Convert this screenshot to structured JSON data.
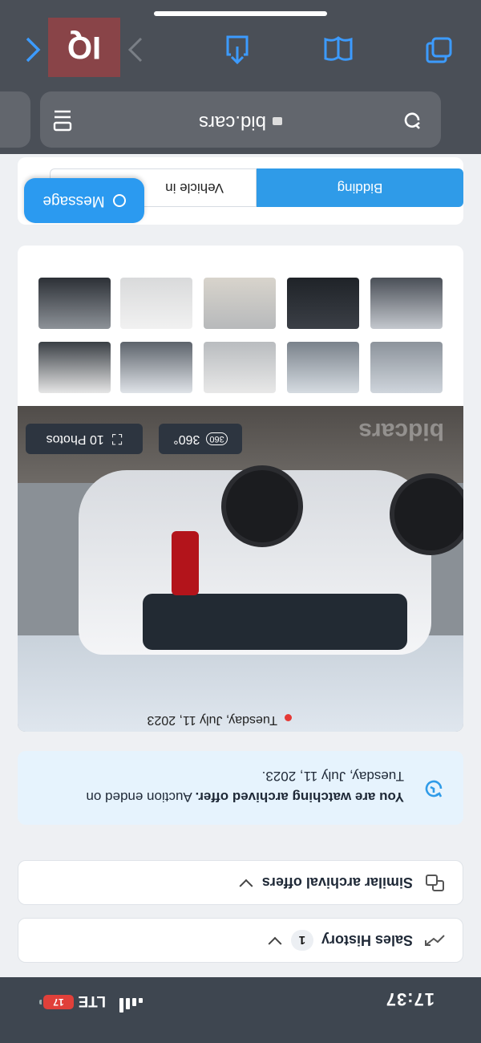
{
  "status_bar": {
    "time": "17:37",
    "network": "LTE",
    "battery": "17"
  },
  "sections": {
    "sales_history": {
      "label": "Sales History",
      "count": "1"
    },
    "similar_offers": {
      "label": "Similar archival offers"
    }
  },
  "notice": {
    "bold": "You are watching archived offer.",
    "rest": " Auction ended on Tuesday, July 11, 2023."
  },
  "listing": {
    "date": "Tuesday, July 11, 2023",
    "photos_label": "10 Photos",
    "view360_label": "360°",
    "view360_badge": "360",
    "watermark": "bidcars",
    "thumbnail_count": 10
  },
  "tabs": [
    {
      "label": "Bidding"
    },
    {
      "label": "Vehicle in"
    }
  ],
  "message_button": "Message",
  "browser": {
    "url": "bid.cars",
    "overlay_logo": "IQ"
  },
  "colors": {
    "accent": "#2f9be8",
    "danger": "#e53935",
    "browser_bar": "#4a4f57"
  }
}
